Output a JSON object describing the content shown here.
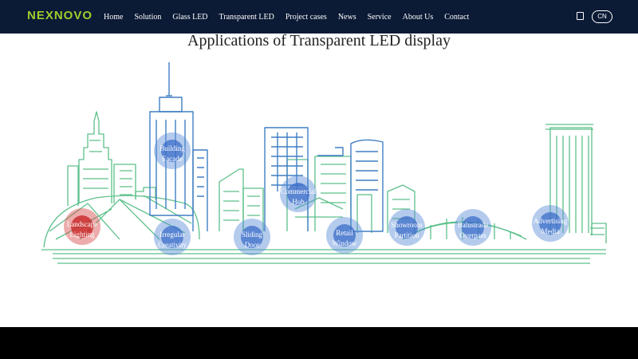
{
  "header": {
    "logo": "NEXNOVO",
    "nav": [
      "Home",
      "Solution",
      "Glass LED",
      "Transparent LED",
      "Project cases",
      "News",
      "Service",
      "About Us",
      "Contact"
    ],
    "lang": "CN"
  },
  "main": {
    "title": "Applications of Transparent LED display",
    "hotspots": [
      {
        "line1": "Landscape",
        "line2": "Lighting"
      },
      {
        "line1": "Irregular",
        "line2": "Creativity"
      },
      {
        "line1": "Building",
        "line2": "Facade"
      },
      {
        "line1": "Sliding",
        "line2": "Door"
      },
      {
        "line1": "Commercial",
        "line2": "Hub"
      },
      {
        "line1": "Retail",
        "line2": "Window"
      },
      {
        "line1": "Showroom",
        "line2": "Partition"
      },
      {
        "line1": "Balustrade",
        "line2": "Overpass"
      },
      {
        "line1": "Advertising",
        "line2": "Media"
      }
    ]
  },
  "colors": {
    "header_bg": "#0b1a35",
    "logo": "#9ccf2d",
    "skyline_green": "#5cc08a",
    "skyline_blue": "#3f7fc4",
    "hotspot_blue": "#3c6ec8",
    "hotspot_active": "#c82828"
  }
}
